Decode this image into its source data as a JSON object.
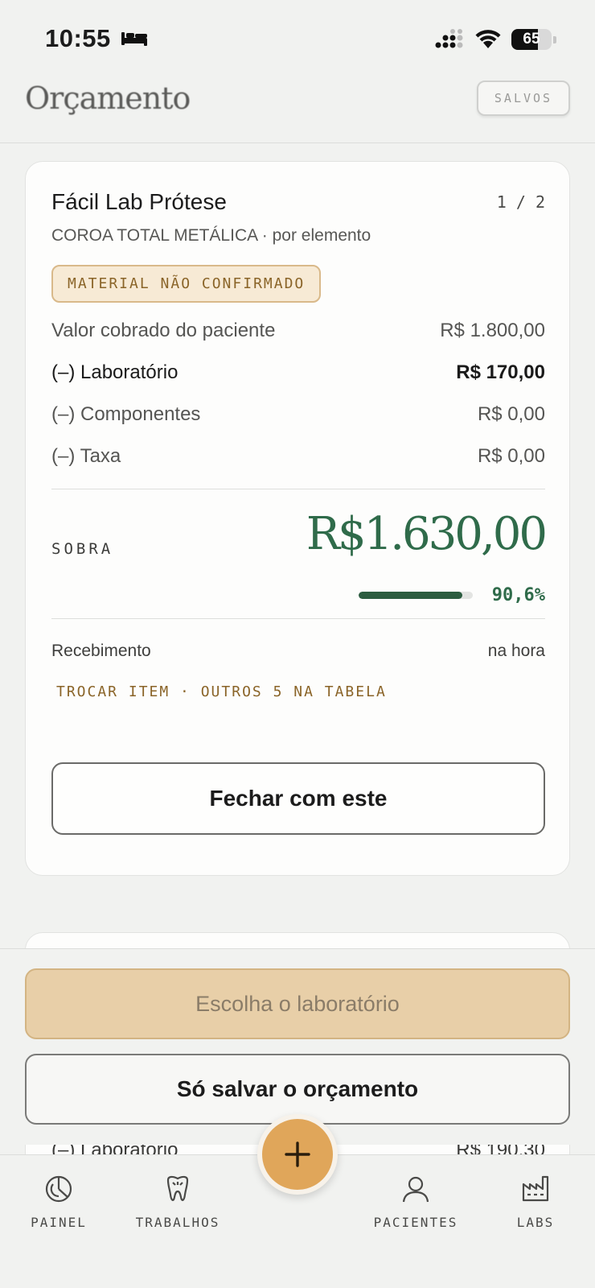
{
  "status_bar": {
    "time": "10:55",
    "battery": "65",
    "battery_level": 0.65
  },
  "header": {
    "title": "Orçamento",
    "saved_label": "SALVOS"
  },
  "card": {
    "lab_name": "Fácil Lab Prótese",
    "pager": "1 / 2",
    "item_desc": "COROA TOTAL METÁLICA · por elemento",
    "badge": "MATERIAL NÃO CONFIRMADO",
    "rows": [
      {
        "label": "Valor cobrado do paciente",
        "value": "R$ 1.800,00"
      },
      {
        "label": "(–) Laboratório",
        "value": "R$ 170,00"
      },
      {
        "label": "(–) Componentes",
        "value": "R$ 0,00"
      },
      {
        "label": "(–) Taxa",
        "value": "R$ 0,00"
      }
    ],
    "sobra_label": "SOBRA",
    "sobra_value": "R$1.630,00",
    "margin_pct": "90,6%",
    "margin_fraction": 0.906,
    "receipt_label": "Recebimento",
    "receipt_value": "na hora",
    "swap_link": "TROCAR ITEM · OUTROS 5 NA TABELA",
    "close_button": "Fechar com este"
  },
  "next_card_peek": {
    "label": "(–) Laboratório",
    "value": "R$ 190,30"
  },
  "actions": {
    "choose_lab": "Escolha o laboratório",
    "save_only": "Só salvar o orçamento"
  },
  "tabs": [
    {
      "label": "PAINEL",
      "icon": "chart-pie-icon"
    },
    {
      "label": "TRABALHOS",
      "icon": "tooth-icon"
    },
    {
      "label": "PACIENTES",
      "icon": "person-icon"
    },
    {
      "label": "LABS",
      "icon": "factory-icon"
    }
  ],
  "colors": {
    "accent_green": "#2f6b4a",
    "accent_amber": "#e0a65a",
    "badge_text": "#8a6428"
  }
}
